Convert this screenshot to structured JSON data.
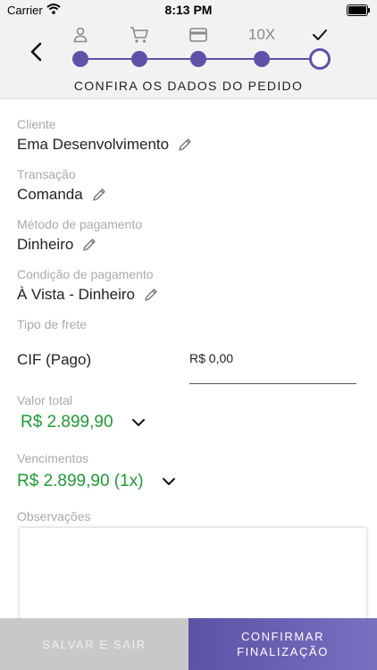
{
  "status_bar": {
    "carrier": "Carrier",
    "time": "8:13 PM"
  },
  "header": {
    "title": "CONFIRA OS DADOS DO PEDIDO",
    "steps": [
      {
        "icon": "person-icon",
        "label": ""
      },
      {
        "icon": "cart-icon",
        "label": ""
      },
      {
        "icon": "credit-card-icon",
        "label": ""
      },
      {
        "icon": "",
        "label": "10X"
      },
      {
        "icon": "checkmark-icon",
        "label": ""
      }
    ],
    "accent_color": "#5e52a8"
  },
  "form": {
    "cliente": {
      "label": "Cliente",
      "value": "Ema Desenvolvimento"
    },
    "transacao": {
      "label": "Transação",
      "value": "Comanda"
    },
    "metodo_pagamento": {
      "label": "Método de pagamento",
      "value": "Dinheiro"
    },
    "condicao_pagamento": {
      "label": "Condição de pagamento",
      "value": "À Vista - Dinheiro"
    },
    "tipo_frete": {
      "label": "Tipo de frete",
      "value": "CIF (Pago)",
      "amount": "R$ 0,00"
    },
    "valor_total": {
      "label": "Valor total",
      "value": "R$ 2.899,90"
    },
    "vencimentos": {
      "label": "Vencimentos",
      "value": "R$ 2.899,90 (1x)"
    },
    "observacoes": {
      "label": "Observações",
      "value": ""
    },
    "value_color": "#1f9a36"
  },
  "actions": {
    "save_label": "SALVAR E SAIR",
    "confirm_label_line1": "CONFIRMAR",
    "confirm_label_line2": "FINALIZAÇÃO"
  }
}
